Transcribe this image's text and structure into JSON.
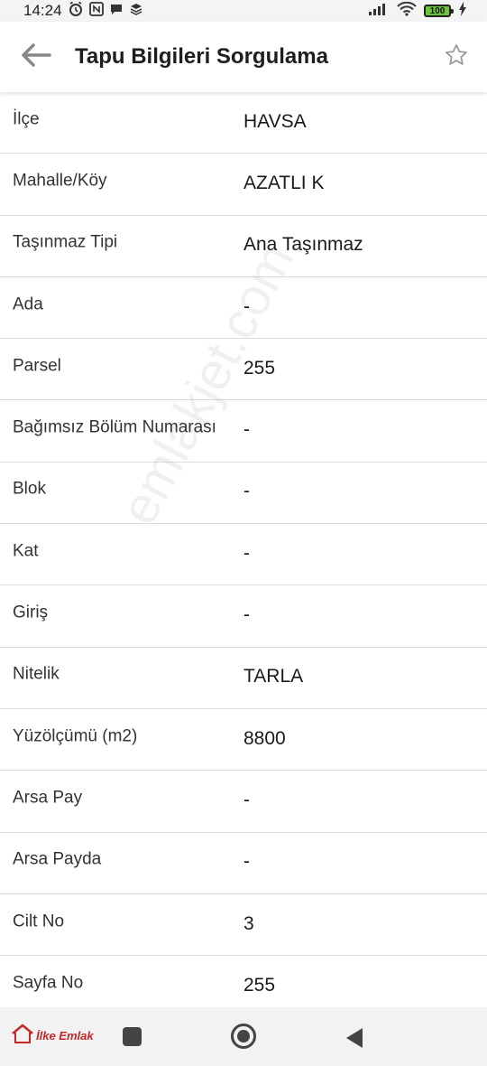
{
  "status_bar": {
    "time": "14:24",
    "battery": "100"
  },
  "app_bar": {
    "title": "Tapu Bilgileri Sorgulama"
  },
  "rows": [
    {
      "label": "İlçe",
      "value": "HAVSA"
    },
    {
      "label": "Mahalle/Köy",
      "value": "AZATLI K"
    },
    {
      "label": "Taşınmaz Tipi",
      "value": "Ana Taşınmaz"
    },
    {
      "label": "Ada",
      "value": "-"
    },
    {
      "label": "Parsel",
      "value": "255"
    },
    {
      "label": "Bağımsız Bölüm Numarası",
      "value": "-"
    },
    {
      "label": "Blok",
      "value": "-"
    },
    {
      "label": "Kat",
      "value": "-"
    },
    {
      "label": "Giriş",
      "value": "-"
    },
    {
      "label": "Nitelik",
      "value": "TARLA"
    },
    {
      "label": "Yüzölçümü (m2)",
      "value": "8800"
    },
    {
      "label": "Arsa Pay",
      "value": "-"
    },
    {
      "label": "Arsa Payda",
      "value": "-"
    },
    {
      "label": "Cilt No",
      "value": "3"
    },
    {
      "label": "Sayfa No",
      "value": "255"
    }
  ],
  "watermark": "emlakjet.com",
  "nav_bar": {
    "logo_text": "İlke Emlak"
  },
  "colors": {
    "accent_red": "#c62828",
    "battery_green": "#6dc23e"
  }
}
